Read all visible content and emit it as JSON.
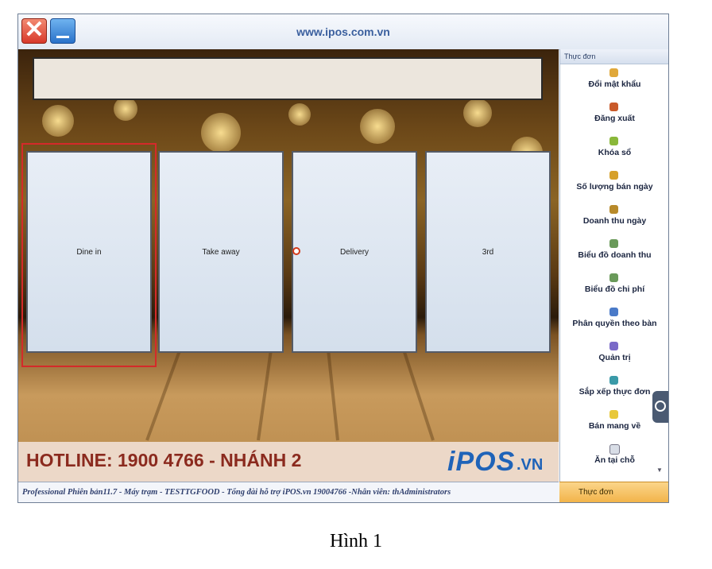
{
  "window": {
    "title": "www.ipos.com.vn"
  },
  "services": [
    {
      "label": "Dine in"
    },
    {
      "label": "Take away"
    },
    {
      "label": "Delivery"
    },
    {
      "label": "3rd"
    }
  ],
  "hotline": {
    "text": "HOTLINE: 1900 4766 - NHÁNH 2",
    "logo_main": "iPOS",
    "logo_suffix": ".VN"
  },
  "statusbar": {
    "text": "Professional Phiên bản11.7 -  Máy trạm  - TESTTGFOOD - Tổng đài hỗ trợ iPOS.vn 19004766 -Nhân viên: thAdministrators"
  },
  "menu": {
    "header": "Thực đơn",
    "items": [
      {
        "label": "Đổi mật khẩu",
        "icon": "key-user-icon"
      },
      {
        "label": "Đăng xuất",
        "icon": "logout-icon"
      },
      {
        "label": "Khóa sổ",
        "icon": "lock-book-icon"
      },
      {
        "label": "Số lượng bán ngày",
        "icon": "sales-count-icon"
      },
      {
        "label": "Doanh thu ngày",
        "icon": "money-bag-icon"
      },
      {
        "label": "Biểu đồ doanh thu",
        "icon": "revenue-chart-icon"
      },
      {
        "label": "Biểu đồ chi phí",
        "icon": "cost-chart-icon"
      },
      {
        "label": "Phân quyền theo bàn",
        "icon": "table-permission-icon"
      },
      {
        "label": "Quản trị",
        "icon": "admin-icon"
      },
      {
        "label": "Sắp xếp thực đơn",
        "icon": "sort-menu-icon"
      },
      {
        "label": "Bán mang về",
        "icon": "takeaway-icon"
      },
      {
        "label": "Ăn tại chỗ",
        "icon": "dine-in-grid-icon"
      }
    ],
    "tab_label": "Thực đơn"
  },
  "caption": "Hình 1",
  "colors": {
    "accent_blue": "#3a5f9e",
    "hotline_red": "#8b2a1e",
    "selection_red": "#d42a2a",
    "menu_tab": "#f2b44a"
  }
}
